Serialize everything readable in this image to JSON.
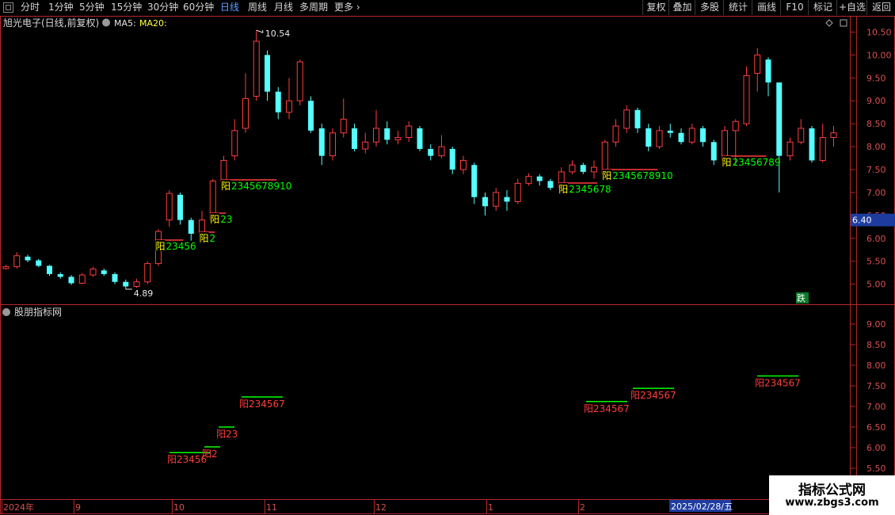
{
  "toolbar": {
    "left_items": [
      {
        "label": "分时",
        "active": false
      },
      {
        "label": "1分钟",
        "active": false
      },
      {
        "label": "5分钟",
        "active": false
      },
      {
        "label": "15分钟",
        "active": false
      },
      {
        "label": "30分钟",
        "active": false
      },
      {
        "label": "60分钟",
        "active": false
      },
      {
        "label": "日线",
        "active": true
      },
      {
        "label": "周线",
        "active": false
      },
      {
        "label": "月线",
        "active": false
      },
      {
        "label": "多周期",
        "active": false
      },
      {
        "label": "更多",
        "active": false
      }
    ],
    "more_chevron": "›",
    "right_buttons": [
      "复权",
      "叠加",
      "多股",
      "统计",
      "画线",
      "F10",
      "标记",
      "+自选",
      "返回"
    ]
  },
  "main_panel": {
    "title": "旭光电子(日线,前复权)",
    "ma5_label": "MA5:",
    "ma20_label": "MA20:",
    "price_axis": [
      "10.50",
      "10.00",
      "9.50",
      "9.00",
      "8.50",
      "8.00",
      "7.50",
      "7.00",
      "6.50",
      "6.00",
      "5.50",
      "5.00"
    ],
    "current_price": "6.40",
    "high_label": "10.54",
    "low_label": "4.89",
    "fall_badge": "跌",
    "signals": [
      {
        "prefix": "阳",
        "text": "23456",
        "bar": 14
      },
      {
        "prefix": "阳",
        "text": "2",
        "bar": 18
      },
      {
        "prefix": "阳",
        "text": "23",
        "bar": 19
      },
      {
        "prefix": "阳",
        "text": "2345678910",
        "bar": 20
      },
      {
        "prefix": "阳",
        "text": "2345678",
        "bar": 51
      },
      {
        "prefix": "阳",
        "text": "2345678910",
        "bar": 55
      },
      {
        "prefix": "阳",
        "text": "23456789",
        "bar": 66
      }
    ]
  },
  "indicator_panel": {
    "title": "股朋指标网",
    "axis": [
      "9.00",
      "8.50",
      "8.00",
      "7.50",
      "7.00",
      "6.50",
      "6.00",
      "5.50"
    ],
    "signals": [
      {
        "label": "阳23456",
        "value": 5.88
      },
      {
        "label": "阳2",
        "value": 6.02
      },
      {
        "label": "阳23",
        "value": 6.5
      },
      {
        "label": "阳234567",
        "value": 7.23
      },
      {
        "label": "阳234567",
        "value": 7.12
      },
      {
        "label": "阳234567",
        "value": 7.44
      },
      {
        "label": "阳234567",
        "value": 7.74
      }
    ]
  },
  "date_axis": {
    "labels": [
      "2024年",
      "9",
      "10",
      "11",
      "12",
      "1",
      "2"
    ],
    "cursor_date": "2025/02/28/五"
  },
  "watermark": {
    "line1": "指标公式网",
    "line2": "www.zbgs3.com"
  },
  "colors": {
    "up": "#ff3c3c",
    "down": "#54ffff",
    "axis": "#b4282a",
    "accent_blue": "#1e3ca0",
    "signal_yellow": "#ffff00",
    "signal_green": "#00ff00"
  },
  "chart_data": {
    "type": "candlestick",
    "y_range": [
      4.7,
      10.75
    ],
    "candles": [
      {
        "o": 5.34,
        "c": 5.38,
        "h": 5.42,
        "l": 5.32
      },
      {
        "o": 5.38,
        "c": 5.62,
        "h": 5.7,
        "l": 5.34
      },
      {
        "o": 5.6,
        "c": 5.52,
        "h": 5.64,
        "l": 5.48
      },
      {
        "o": 5.52,
        "c": 5.4,
        "h": 5.55,
        "l": 5.37
      },
      {
        "o": 5.4,
        "c": 5.22,
        "h": 5.42,
        "l": 5.18
      },
      {
        "o": 5.22,
        "c": 5.16,
        "h": 5.26,
        "l": 5.12
      },
      {
        "o": 5.16,
        "c": 5.02,
        "h": 5.2,
        "l": 4.98
      },
      {
        "o": 5.02,
        "c": 5.2,
        "h": 5.24,
        "l": 5.0
      },
      {
        "o": 5.2,
        "c": 5.33,
        "h": 5.38,
        "l": 5.16
      },
      {
        "o": 5.3,
        "c": 5.22,
        "h": 5.34,
        "l": 5.18
      },
      {
        "o": 5.22,
        "c": 5.05,
        "h": 5.26,
        "l": 5.0
      },
      {
        "o": 5.05,
        "c": 4.95,
        "h": 5.1,
        "l": 4.89
      },
      {
        "o": 4.95,
        "c": 5.05,
        "h": 5.12,
        "l": 4.92
      },
      {
        "o": 5.05,
        "c": 5.45,
        "h": 5.5,
        "l": 5.0
      },
      {
        "o": 5.45,
        "c": 6.15,
        "h": 6.2,
        "l": 5.4
      },
      {
        "o": 6.4,
        "c": 6.98,
        "h": 7.05,
        "l": 6.25
      },
      {
        "o": 6.95,
        "c": 6.4,
        "h": 7.0,
        "l": 6.3
      },
      {
        "o": 6.4,
        "c": 6.1,
        "h": 6.45,
        "l": 5.95
      },
      {
        "o": 6.1,
        "c": 6.4,
        "h": 6.6,
        "l": 6.0
      },
      {
        "o": 6.4,
        "c": 7.25,
        "h": 7.3,
        "l": 6.35
      },
      {
        "o": 7.25,
        "c": 7.7,
        "h": 7.8,
        "l": 7.15
      },
      {
        "o": 7.8,
        "c": 8.35,
        "h": 8.6,
        "l": 7.7
      },
      {
        "o": 8.4,
        "c": 9.05,
        "h": 9.6,
        "l": 8.3
      },
      {
        "o": 9.1,
        "c": 10.3,
        "h": 10.54,
        "l": 9.0
      },
      {
        "o": 10.0,
        "c": 9.2,
        "h": 10.1,
        "l": 9.0
      },
      {
        "o": 9.2,
        "c": 8.75,
        "h": 9.3,
        "l": 8.6
      },
      {
        "o": 8.75,
        "c": 9.0,
        "h": 9.5,
        "l": 8.6
      },
      {
        "o": 9.0,
        "c": 9.85,
        "h": 9.9,
        "l": 8.9
      },
      {
        "o": 9.0,
        "c": 8.35,
        "h": 9.1,
        "l": 8.3
      },
      {
        "o": 8.4,
        "c": 7.8,
        "h": 8.5,
        "l": 7.6
      },
      {
        "o": 7.8,
        "c": 8.3,
        "h": 8.4,
        "l": 7.7
      },
      {
        "o": 8.3,
        "c": 8.6,
        "h": 9.05,
        "l": 8.2
      },
      {
        "o": 8.4,
        "c": 7.95,
        "h": 8.5,
        "l": 7.9
      },
      {
        "o": 7.95,
        "c": 8.1,
        "h": 8.3,
        "l": 7.85
      },
      {
        "o": 8.1,
        "c": 8.4,
        "h": 8.8,
        "l": 8.0
      },
      {
        "o": 8.4,
        "c": 8.15,
        "h": 8.55,
        "l": 8.05
      },
      {
        "o": 8.15,
        "c": 8.2,
        "h": 8.35,
        "l": 8.05
      },
      {
        "o": 8.2,
        "c": 8.45,
        "h": 8.55,
        "l": 8.1
      },
      {
        "o": 8.4,
        "c": 7.95,
        "h": 8.45,
        "l": 7.9
      },
      {
        "o": 7.95,
        "c": 7.8,
        "h": 8.05,
        "l": 7.7
      },
      {
        "o": 7.8,
        "c": 8.0,
        "h": 8.25,
        "l": 7.75
      },
      {
        "o": 7.95,
        "c": 7.5,
        "h": 8.0,
        "l": 7.4
      },
      {
        "o": 7.5,
        "c": 7.7,
        "h": 7.8,
        "l": 7.4
      },
      {
        "o": 7.6,
        "c": 6.9,
        "h": 7.65,
        "l": 6.75
      },
      {
        "o": 6.9,
        "c": 6.7,
        "h": 7.0,
        "l": 6.5
      },
      {
        "o": 6.7,
        "c": 7.0,
        "h": 7.1,
        "l": 6.6
      },
      {
        "o": 6.9,
        "c": 6.8,
        "h": 7.05,
        "l": 6.6
      },
      {
        "o": 6.8,
        "c": 7.2,
        "h": 7.3,
        "l": 6.75
      },
      {
        "o": 7.2,
        "c": 7.35,
        "h": 7.42,
        "l": 7.15
      },
      {
        "o": 7.35,
        "c": 7.25,
        "h": 7.4,
        "l": 7.15
      },
      {
        "o": 7.25,
        "c": 7.1,
        "h": 7.3,
        "l": 7.05
      },
      {
        "o": 7.1,
        "c": 7.45,
        "h": 7.55,
        "l": 7.05
      },
      {
        "o": 7.45,
        "c": 7.6,
        "h": 7.7,
        "l": 7.4
      },
      {
        "o": 7.6,
        "c": 7.45,
        "h": 7.65,
        "l": 7.4
      },
      {
        "o": 7.45,
        "c": 7.55,
        "h": 7.7,
        "l": 7.3
      },
      {
        "o": 7.4,
        "c": 8.1,
        "h": 8.15,
        "l": 7.35
      },
      {
        "o": 8.1,
        "c": 8.45,
        "h": 8.6,
        "l": 8.0
      },
      {
        "o": 8.4,
        "c": 8.8,
        "h": 8.9,
        "l": 8.3
      },
      {
        "o": 8.8,
        "c": 8.4,
        "h": 8.85,
        "l": 8.3
      },
      {
        "o": 8.4,
        "c": 8.0,
        "h": 8.5,
        "l": 7.9
      },
      {
        "o": 8.0,
        "c": 8.35,
        "h": 8.45,
        "l": 7.95
      },
      {
        "o": 8.35,
        "c": 8.3,
        "h": 8.5,
        "l": 8.2
      },
      {
        "o": 8.3,
        "c": 8.1,
        "h": 8.4,
        "l": 8.05
      },
      {
        "o": 8.1,
        "c": 8.4,
        "h": 8.5,
        "l": 8.05
      },
      {
        "o": 8.4,
        "c": 8.1,
        "h": 8.45,
        "l": 8.0
      },
      {
        "o": 8.1,
        "c": 7.7,
        "h": 8.15,
        "l": 7.6
      },
      {
        "o": 7.7,
        "c": 8.35,
        "h": 8.45,
        "l": 7.65
      },
      {
        "o": 8.35,
        "c": 8.55,
        "h": 8.6,
        "l": 7.6
      },
      {
        "o": 8.5,
        "c": 9.55,
        "h": 9.75,
        "l": 8.45
      },
      {
        "o": 9.6,
        "c": 10.0,
        "h": 10.15,
        "l": 9.2
      },
      {
        "o": 9.9,
        "c": 9.4,
        "h": 9.95,
        "l": 9.1
      },
      {
        "o": 9.4,
        "c": 7.8,
        "h": 9.0,
        "l": 7.0
      },
      {
        "o": 7.8,
        "c": 8.1,
        "h": 8.2,
        "l": 7.7
      },
      {
        "o": 8.1,
        "c": 8.4,
        "h": 8.6,
        "l": 8.05
      },
      {
        "o": 8.4,
        "c": 7.7,
        "h": 8.45,
        "l": 7.65
      },
      {
        "o": 7.7,
        "c": 8.2,
        "h": 8.5,
        "l": 7.65
      },
      {
        "o": 8.2,
        "c": 8.3,
        "h": 8.45,
        "l": 8.0
      }
    ]
  }
}
